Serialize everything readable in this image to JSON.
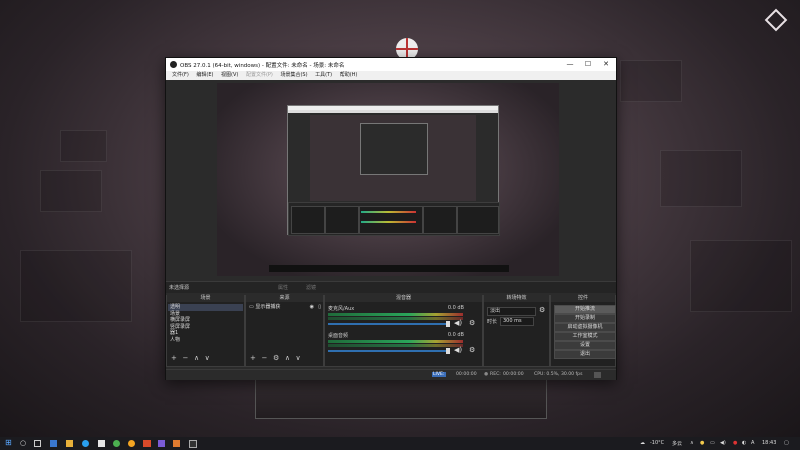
{
  "window": {
    "title": "OBS 27.0.1 (64-bit, windows) - 配置文件: 未命名 - 场景: 未命名",
    "controls": {
      "minimize": "—",
      "maximize": "☐",
      "close": "✕"
    }
  },
  "menu": [
    "文件(F)",
    "编辑(E)",
    "视图(V)",
    "配置文件(P)",
    "场景集合(S)",
    "工具(T)",
    "帮助(H)"
  ],
  "context_bar": {
    "no_source": "未选择源",
    "properties": "属性",
    "filters": "滤镜"
  },
  "docks": {
    "scenes": {
      "title": "场景",
      "items": [
        "透明",
        "场景",
        "横屏录屏",
        "竖屏录屏",
        "器1",
        "人物"
      ],
      "selected_index": 0
    },
    "sources": {
      "title": "来源",
      "items": [
        {
          "label": "显示器捕获",
          "visible": true,
          "locked": true
        }
      ]
    },
    "mixer": {
      "title": "混音器",
      "channels": [
        {
          "name": "麦克风/Aux",
          "db": "0.0 dB"
        },
        {
          "name": "桌面音频",
          "db": "0.0 dB"
        }
      ]
    },
    "transitions": {
      "title": "转场特效",
      "type": "淡出",
      "duration_label": "时长",
      "duration": "300 ms"
    },
    "controls": {
      "title": "控件",
      "buttons": [
        "开始推流",
        "开始录制",
        "启动虚拟摄像机",
        "工作室模式",
        "设置",
        "退出"
      ],
      "hover_index": 0
    }
  },
  "status": {
    "live_label": "LIVE:",
    "live_time": "00:00:00",
    "rec_label": "REC:",
    "rec_time": "00:00:00",
    "cpu": "CPU: 0.5%, 30.00 fps"
  },
  "taskbar": {
    "weather": "-10°C",
    "weather_text": "多云",
    "lang": "A",
    "time": "18:43"
  },
  "tool_glyphs": {
    "add": "+",
    "remove": "−",
    "settings": "⚙",
    "up": "∧",
    "down": "∨"
  }
}
